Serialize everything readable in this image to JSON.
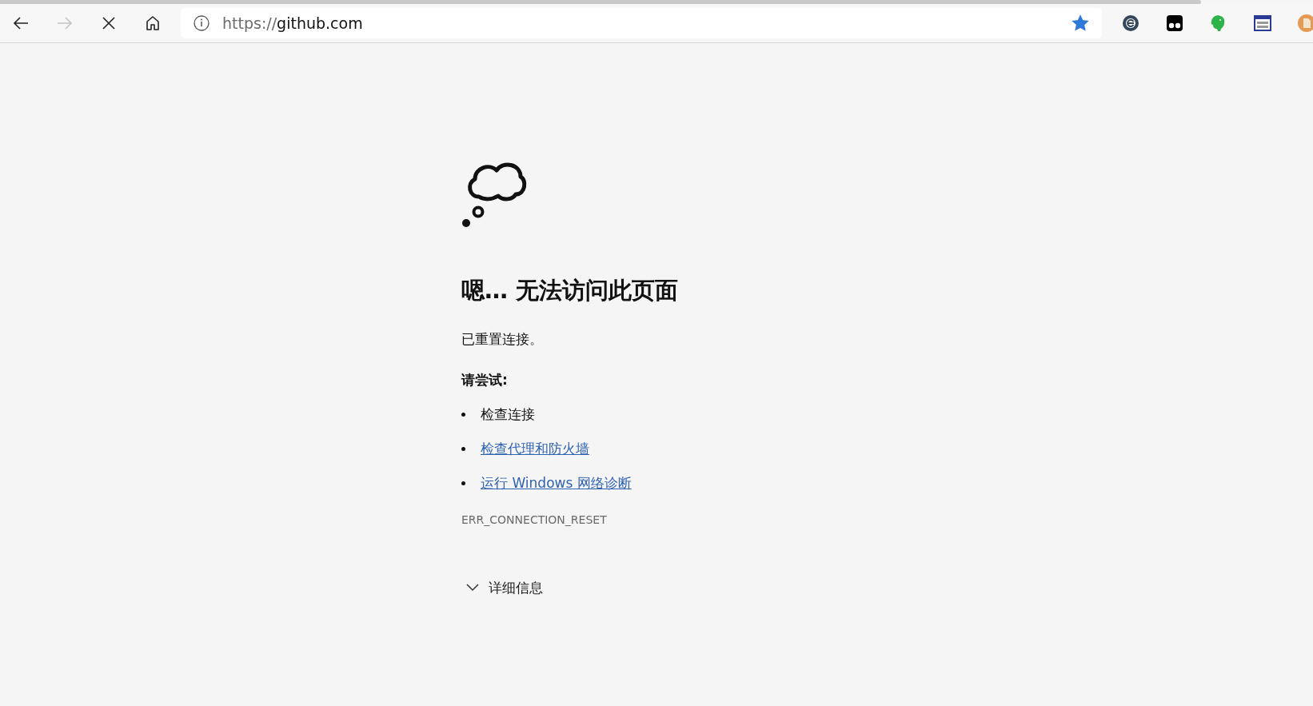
{
  "loading": {
    "level": 0.915
  },
  "toolbar": {
    "back": {
      "disabled": false
    },
    "forward": {
      "disabled": true
    },
    "url_scheme": "https://",
    "url_host": "github.com",
    "bookmarked": true
  },
  "extensions": [
    {
      "kind": "e-badge"
    },
    {
      "kind": "glasses"
    },
    {
      "kind": "elephant"
    },
    {
      "kind": "window"
    },
    {
      "kind": "page"
    }
  ],
  "error": {
    "title": "嗯… 无法访问此页面",
    "message": "已重置连接。",
    "try_heading": "请尝试:",
    "suggestions": [
      {
        "text": "检查连接",
        "link": false
      },
      {
        "text": "检查代理和防火墙",
        "link": true
      },
      {
        "text": "运行 Windows 网络诊断",
        "link": true
      }
    ],
    "code": "ERR_CONNECTION_RESET",
    "details": {
      "label": "详细信息",
      "expanded": false
    }
  }
}
